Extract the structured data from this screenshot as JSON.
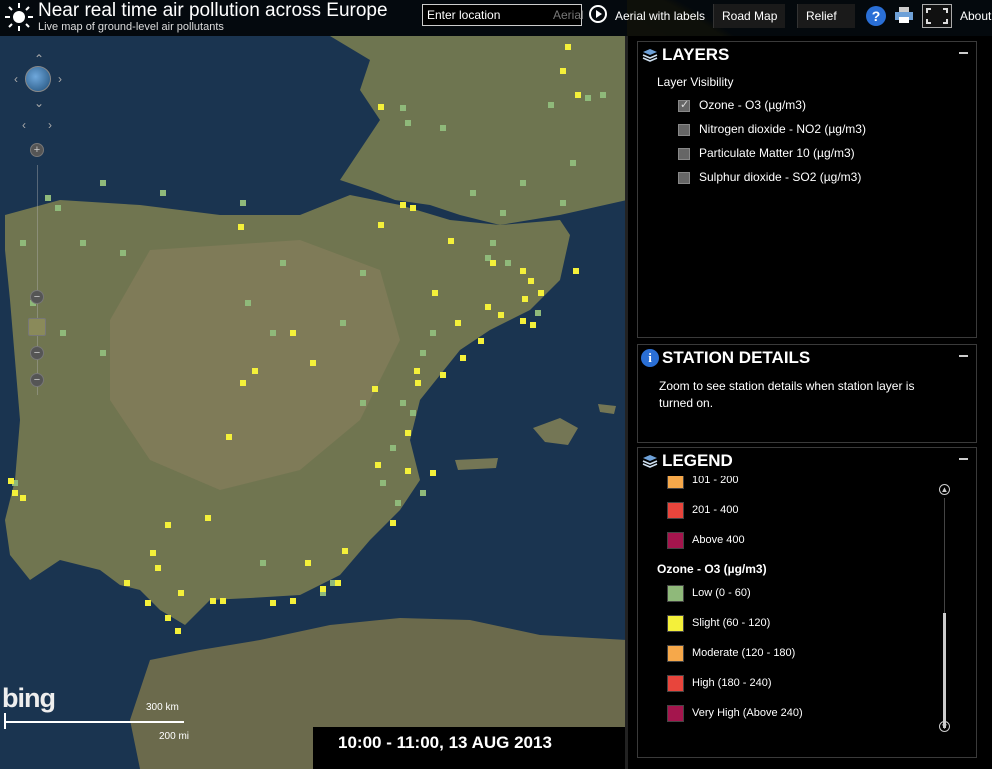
{
  "header": {
    "title": "Near real time air pollution across Europe",
    "subtitle": "Live map of ground-level air pollutants",
    "location_placeholder": "Enter location",
    "aerial_ghost": "Aerial",
    "buttons": {
      "aerial_labels": "Aerial with labels",
      "road_map": "Road Map",
      "relief": "Relief"
    },
    "about": "About",
    "help": "?"
  },
  "map": {
    "bing": "bing",
    "scale_km": "300 km",
    "scale_mi": "200 mi",
    "station_colors": {
      "low": "#8fb97a",
      "slight": "#f4f03a"
    }
  },
  "timebar": {
    "time": "10:00 - 11:00, 13 AUG 2013"
  },
  "layers": {
    "title": "LAYERS",
    "visibility_label": "Layer Visibility",
    "items": [
      {
        "label": "Ozone - O3 (µg/m3)",
        "checked": true
      },
      {
        "label": "Nitrogen dioxide - NO2 (µg/m3)",
        "checked": false
      },
      {
        "label": "Particulate Matter 10 (µg/m3)",
        "checked": false
      },
      {
        "label": "Sulphur dioxide - SO2 (µg/m3)",
        "checked": false
      }
    ]
  },
  "station_details": {
    "title": "STATION DETAILS",
    "text": "Zoom to see station details when station layer is turned on.",
    "info": "i"
  },
  "legend": {
    "title": "LEGEND",
    "partial_items": [
      {
        "label": "101 - 200",
        "color": "#f6a84a"
      },
      {
        "label": "201 - 400",
        "color": "#e8453c"
      },
      {
        "label": "Above 400",
        "color": "#a4154d"
      }
    ],
    "ozone_title": "Ozone - O3 (µg/m3)",
    "ozone_items": [
      {
        "label": "Low (0 - 60)",
        "color": "#8fb97a"
      },
      {
        "label": "Slight (60 - 120)",
        "color": "#f4f03a"
      },
      {
        "label": "Moderate (120 - 180)",
        "color": "#f6a84a"
      },
      {
        "label": "High (180 - 240)",
        "color": "#e8453c"
      },
      {
        "label": "Very High (Above 240)",
        "color": "#a4154d"
      }
    ]
  }
}
